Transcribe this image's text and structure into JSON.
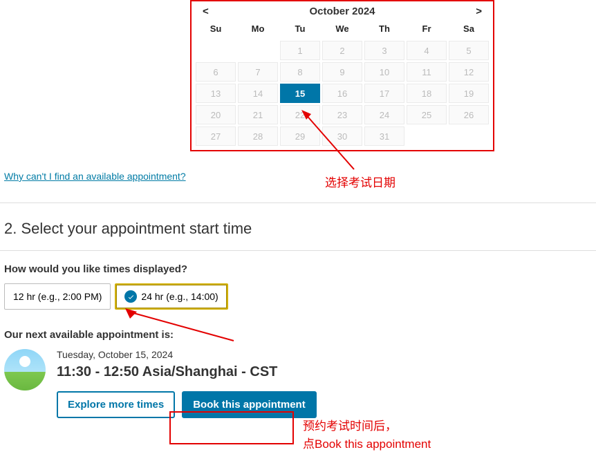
{
  "calendar": {
    "title": "October 2024",
    "prev": "<",
    "next": ">",
    "dow": [
      "Su",
      "Mo",
      "Tu",
      "We",
      "Th",
      "Fr",
      "Sa"
    ],
    "days": [
      {
        "n": "",
        "type": "empty"
      },
      {
        "n": "",
        "type": "empty"
      },
      {
        "n": "1"
      },
      {
        "n": "2"
      },
      {
        "n": "3"
      },
      {
        "n": "4"
      },
      {
        "n": "5"
      },
      {
        "n": "6"
      },
      {
        "n": "7"
      },
      {
        "n": "8"
      },
      {
        "n": "9"
      },
      {
        "n": "10"
      },
      {
        "n": "11"
      },
      {
        "n": "12"
      },
      {
        "n": "13"
      },
      {
        "n": "14"
      },
      {
        "n": "15",
        "selected": true
      },
      {
        "n": "16"
      },
      {
        "n": "17"
      },
      {
        "n": "18"
      },
      {
        "n": "19"
      },
      {
        "n": "20"
      },
      {
        "n": "21"
      },
      {
        "n": "22"
      },
      {
        "n": "23"
      },
      {
        "n": "24"
      },
      {
        "n": "25"
      },
      {
        "n": "26"
      },
      {
        "n": "27"
      },
      {
        "n": "28"
      },
      {
        "n": "29"
      },
      {
        "n": "30"
      },
      {
        "n": "31"
      },
      {
        "n": "",
        "type": "empty"
      },
      {
        "n": "",
        "type": "empty"
      }
    ]
  },
  "links": {
    "why_unavailable": "Why can't I find an available appointment?"
  },
  "annotations": {
    "select_date": "选择考试日期",
    "after_book_line1": "预约考试时间后，",
    "after_book_line2": "点Book this appointment"
  },
  "section": {
    "title": "2. Select your appointment start time",
    "time_prompt": "How would you like times displayed?",
    "fmt12": "12 hr (e.g., 2:00 PM)",
    "fmt24": "24 hr (e.g., 14:00)"
  },
  "appointment": {
    "next_label": "Our next available appointment is:",
    "date": "Tuesday, October 15, 2024",
    "slot": "11:30 - 12:50 Asia/Shanghai - CST",
    "explore": "Explore more times",
    "book": "Book this appointment"
  },
  "colors": {
    "accent": "#0076a8",
    "annotation": "#e30000"
  }
}
